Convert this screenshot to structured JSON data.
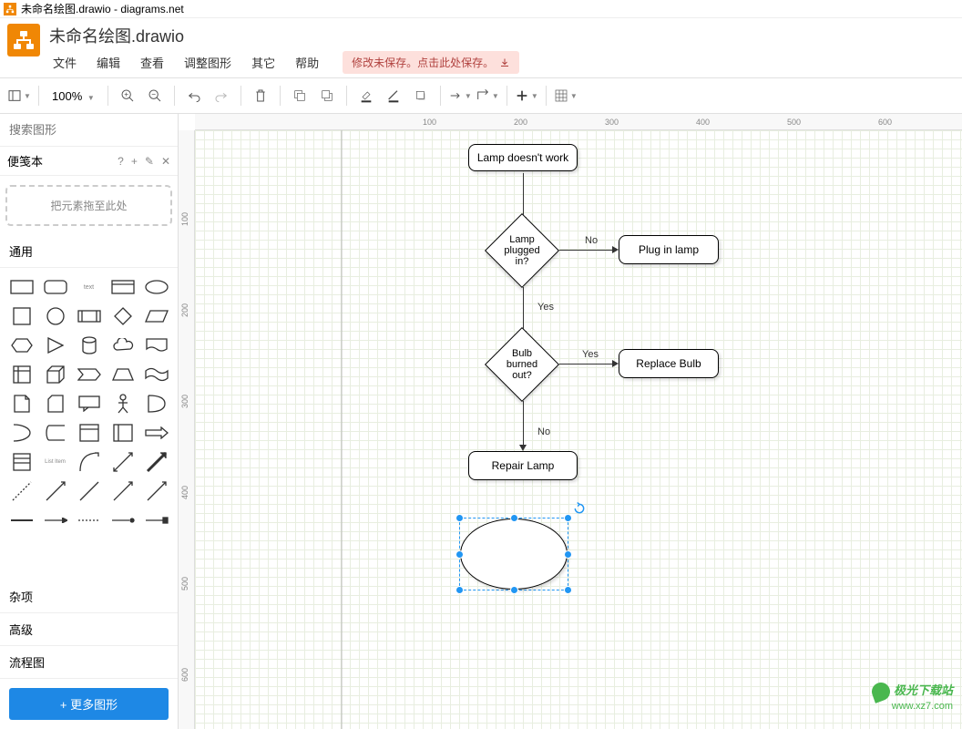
{
  "window": {
    "title": "未命名绘图.drawio - diagrams.net"
  },
  "header": {
    "doc_title": "未命名绘图.drawio"
  },
  "menubar": {
    "file": "文件",
    "edit": "编辑",
    "view": "查看",
    "arrange": "调整图形",
    "extras": "其它",
    "help": "帮助"
  },
  "save_warning": {
    "text": "修改未保存。点击此处保存。"
  },
  "toolbar": {
    "zoom": "100%"
  },
  "sidebar": {
    "search_placeholder": "搜索图形",
    "scratchpad": {
      "title": "便笺本",
      "drop_hint": "把元素拖至此处"
    },
    "sections": {
      "general": "通用",
      "misc": "杂项",
      "advanced": "高级",
      "flowchart": "流程图"
    },
    "more_shapes": "+ 更多图形"
  },
  "flowchart": {
    "n1": "Lamp doesn't work",
    "n2": "Lamp plugged in?",
    "n3": "Plug in lamp",
    "n4": "Bulb burned out?",
    "n5": "Replace Bulb",
    "n6": "Repair Lamp",
    "e_no1": "No",
    "e_yes1": "Yes",
    "e_yes2": "Yes",
    "e_no2": "No"
  },
  "ruler_h": [
    "100",
    "200",
    "300",
    "400",
    "500",
    "600"
  ],
  "ruler_v": [
    "100",
    "200",
    "300",
    "400",
    "500",
    "600",
    "700"
  ],
  "watermark": {
    "line1": "极光下载站",
    "line2": "www.xz7.com"
  }
}
